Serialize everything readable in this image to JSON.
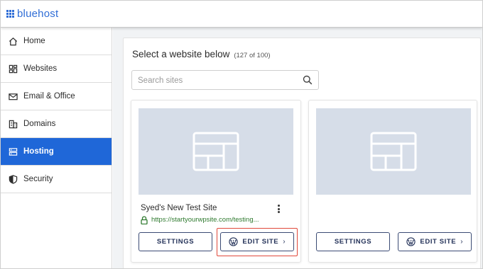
{
  "brand": {
    "name": "bluehost",
    "color": "#2f6dd6"
  },
  "sidebar": {
    "items": [
      {
        "label": "Home",
        "icon": "home-icon",
        "active": false
      },
      {
        "label": "Websites",
        "icon": "websites-icon",
        "active": false
      },
      {
        "label": "Email & Office",
        "icon": "mail-icon",
        "active": false
      },
      {
        "label": "Domains",
        "icon": "domains-icon",
        "active": false
      },
      {
        "label": "Hosting",
        "icon": "server-icon",
        "active": true
      },
      {
        "label": "Security",
        "icon": "shield-icon",
        "active": false
      }
    ],
    "active_color": "#1f67d8"
  },
  "main": {
    "title": "Select a website below",
    "count": "(127 of 100)",
    "search": {
      "placeholder": "Search sites",
      "value": ""
    },
    "cards": [
      {
        "site_name": "Syed's New Test Site",
        "site_url": "https://startyourwpsite.com/testing...",
        "settings_label": "SETTINGS",
        "edit_label": "EDIT SITE",
        "highlighted": true
      },
      {
        "site_name": "",
        "site_url": "",
        "settings_label": "SETTINGS",
        "edit_label": "EDIT SITE",
        "highlighted": false
      }
    ]
  },
  "colors": {
    "highlight": "#e0483a",
    "url_green": "#2f7a2f",
    "button_text": "#25335a"
  }
}
